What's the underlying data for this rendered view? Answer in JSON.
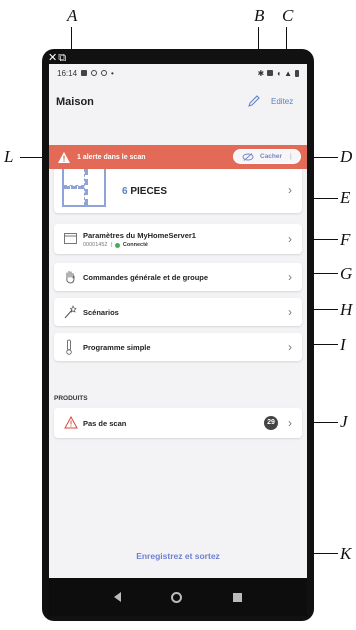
{
  "callouts": {
    "A": "A",
    "B": "B",
    "C": "C",
    "D": "D",
    "E": "E",
    "F": "F",
    "G": "G",
    "H": "H",
    "I": "I",
    "J": "J",
    "K": "K",
    "L": "L"
  },
  "status_bar": {
    "time": "16:14"
  },
  "header": {
    "title": "Maison",
    "edit_label": "Editez"
  },
  "alert": {
    "text": "1 alerte dans le scan",
    "hide_label": "Cacher",
    "separator": "|",
    "color": "#e26a57"
  },
  "rooms": {
    "count": "6",
    "label": "PIECES"
  },
  "server": {
    "title": "Paramètres du MyHomeServer1",
    "id": "00001452",
    "separator": "|",
    "status": "Connecté",
    "status_color": "#4bab55"
  },
  "menu": [
    {
      "label": "Commandes générale et de groupe",
      "icon": "hand-icon"
    },
    {
      "label": "Scénarios",
      "icon": "magic-wand-icon"
    },
    {
      "label": "Programme simple",
      "icon": "thermometer-icon"
    }
  ],
  "products": {
    "section_title": "PRODUITS",
    "scan_label": "Pas de scan",
    "badge": "29"
  },
  "footer": {
    "save_label": "Enregistrez et sortez"
  },
  "colors": {
    "accent": "#5b7fc0",
    "link": "#6c7fd0"
  }
}
